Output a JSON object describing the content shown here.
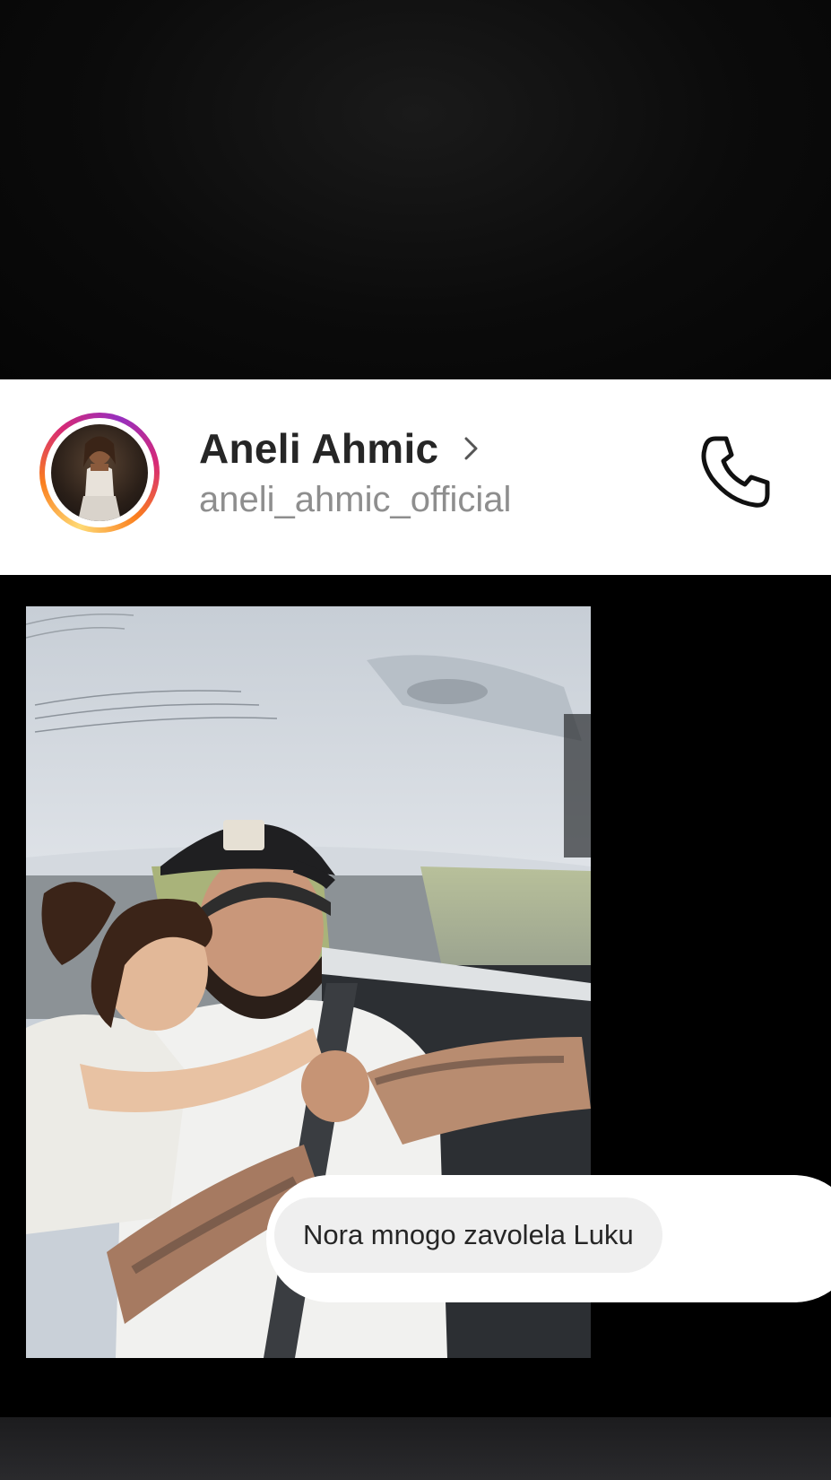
{
  "profile": {
    "display_name": "Aneli Ahmic",
    "username": "aneli_ahmic_official",
    "avatar_icon": "profile-photo",
    "chevron_icon": "chevron-right-icon",
    "call_icon": "phone-icon",
    "ring_colors": [
      "#feda75",
      "#fa7e1e",
      "#d62976",
      "#962fbf"
    ]
  },
  "media": {
    "type": "photo",
    "subject": "car-interior-photo"
  },
  "reply": {
    "text": "Nora mnogo zavolela Luku"
  },
  "colors": {
    "background": "#000000",
    "header_bg": "#ffffff",
    "name_text": "#262626",
    "username_text": "#8e8e8e",
    "bubble_bg": "#efefef"
  }
}
